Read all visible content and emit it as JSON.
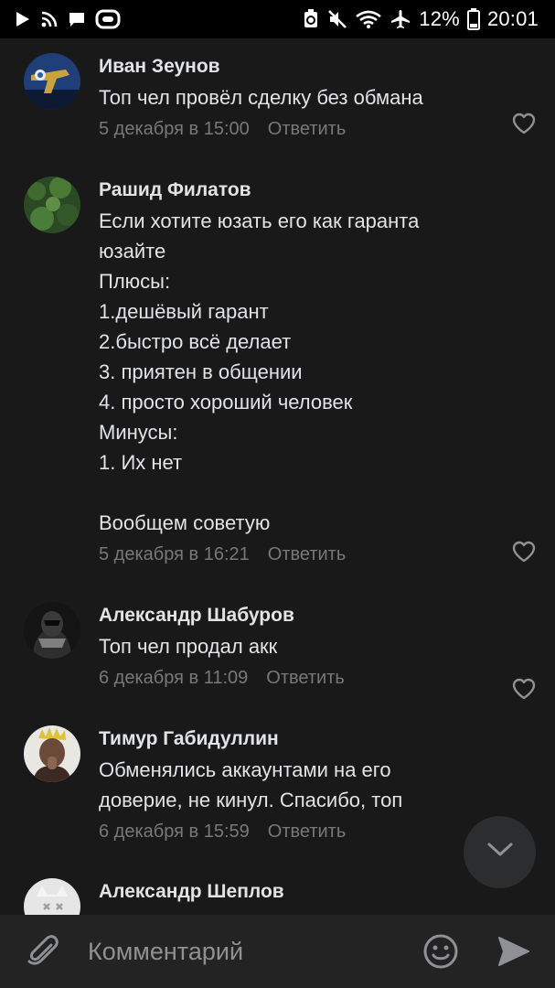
{
  "status_bar": {
    "battery_percent": "12%",
    "time": "20:01",
    "icons_left": [
      "play-icon",
      "rss-icon",
      "message-icon",
      "vr-icon"
    ],
    "icons_right": [
      "recycle-icon",
      "mute-icon",
      "wifi-icon",
      "airplane-icon",
      "battery-icon"
    ]
  },
  "comments": [
    {
      "author": "Иван Зеунов",
      "text": "Топ чел провёл сделку без обмана",
      "date": "5 декабря в 15:00",
      "reply_label": "Ответить"
    },
    {
      "author": "Рашид Филатов",
      "text": "Если хотите юзать его как гаранта\nюзайте\nПлюсы:\n1.дешёвый гарант\n2.быстро всё делает\n3. приятен в общении\n4. просто хороший человек\nМинусы:\n1. Их нет\n\nВообщем советую",
      "date": "5 декабря в 16:21",
      "reply_label": "Ответить"
    },
    {
      "author": "Александр Шабуров",
      "text": "Топ чел продал акк",
      "date": "6 декабря в 11:09",
      "reply_label": "Ответить"
    },
    {
      "author": "Тимур Габидуллин",
      "text": "Обменялись аккаунтами на его\nдоверие, не кинул. Спасибо, топ",
      "date": "6 декабря в 15:59",
      "reply_label": "Ответить"
    },
    {
      "author": "Александр Шеплов",
      "text": "",
      "date": "",
      "reply_label": ""
    }
  ],
  "composer": {
    "placeholder": "Комментарий"
  },
  "colors": {
    "background": "#191919",
    "text": "#e1e3e6",
    "secondary_text": "#76787a",
    "composer_bg": "#232324"
  }
}
